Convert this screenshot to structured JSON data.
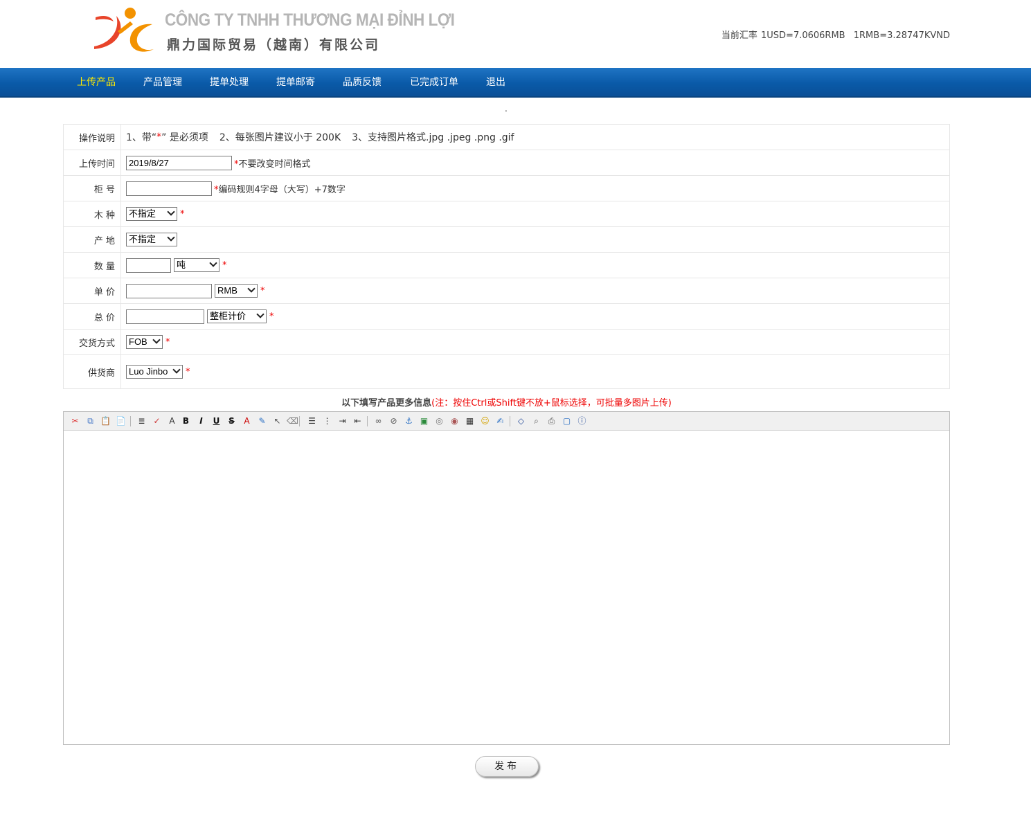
{
  "header": {
    "company_vn": "CÔNG TY TNHH THƯƠNG MẠI ĐỈNH LỢI",
    "company_cn": "鼎力国际贸易（越南）有限公司",
    "rate_label": "当前汇率",
    "rate_usd": "1USD=7.0606RMB",
    "rate_rmb": "1RMB=3.28747KVND",
    "colors": {
      "logo_orange": "#f39200",
      "logo_red": "#e8442a",
      "nav_blue": "#0a5aa8"
    }
  },
  "nav": {
    "items": [
      {
        "label": "上传产品",
        "active": true
      },
      {
        "label": "产品管理",
        "active": false
      },
      {
        "label": "提单处理",
        "active": false
      },
      {
        "label": "提单邮寄",
        "active": false
      },
      {
        "label": "品质反馈",
        "active": false
      },
      {
        "label": "已完成订单",
        "active": false
      },
      {
        "label": "退出",
        "active": false
      }
    ]
  },
  "dot": ".",
  "form": {
    "instructions": {
      "label": "操作说明",
      "part1_a": "1、带“",
      "part1_star": "*",
      "part1_b": "” 是必须项",
      "part2": "2、每张图片建议小于 200K",
      "part3": "3、支持图片格式.jpg  .jpeg  .png  .gif"
    },
    "upload_time": {
      "label": "上传时间",
      "value": "2019/8/27",
      "note": "*不要改变时间格式"
    },
    "container_no": {
      "label": "柜 号",
      "value": "",
      "note": "*编码规则4字母（大写）+7数字"
    },
    "wood": {
      "label": "木 种",
      "selected": "不指定"
    },
    "origin": {
      "label": "产 地",
      "selected": "不指定"
    },
    "quantity": {
      "label": "数 量",
      "value": "",
      "unit": "吨"
    },
    "unit_price": {
      "label": "单 价",
      "value": "",
      "currency": "RMB"
    },
    "total_price": {
      "label": "总 价",
      "value": "",
      "mode": "整柜计价"
    },
    "delivery": {
      "label": "交货方式",
      "selected": "FOB"
    },
    "supplier": {
      "label": "供货商",
      "selected": "Luo Jinbo"
    },
    "star": "*"
  },
  "more_info": {
    "title": "以下填写产品更多信息",
    "note": "(注：按住Ctrl或Shift键不放+鼠标选择，可批量多图片上传)"
  },
  "editor": {
    "icons": [
      "cut-icon",
      "copy-icon",
      "paste-icon",
      "paste-text-icon",
      "format-icon",
      "spellcheck-icon",
      "font-size-icon",
      "bold-icon",
      "italic-icon",
      "underline-icon",
      "strikethrough-icon",
      "font-color-icon",
      "highlight-icon",
      "select-icon",
      "eraser-icon",
      "align-icon",
      "ordered-list-icon",
      "indent-icon",
      "outdent-icon",
      "link-icon",
      "unlink-icon",
      "anchor-icon",
      "image-icon",
      "flash-icon",
      "media-icon",
      "table-icon",
      "smiley-icon",
      "edit-icon",
      "source-icon",
      "preview-icon",
      "print-icon",
      "fullscreen-icon",
      "about-icon"
    ]
  },
  "publish_label": "发布"
}
